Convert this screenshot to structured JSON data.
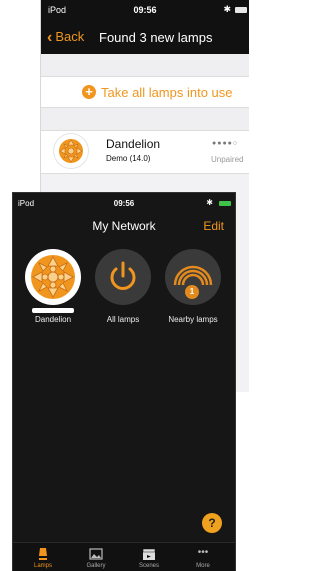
{
  "back_screen": {
    "status": {
      "carrier": "iPod",
      "time": "09:56"
    },
    "nav": {
      "back_label": "Back",
      "title": "Found 3 new lamps"
    },
    "take_all_label": "Take all lamps into use",
    "lamp": {
      "name": "Dandelion",
      "subtitle": "Demo (14.0)",
      "signal": "●●●●○",
      "status": "Unpaired"
    }
  },
  "front_screen": {
    "status": {
      "carrier": "iPod",
      "time": "09:56"
    },
    "nav": {
      "title": "My Network",
      "edit_label": "Edit"
    },
    "tiles": [
      {
        "label": "Dandelion",
        "icon": "dandelion-lamp-icon"
      },
      {
        "label": "All lamps",
        "icon": "power-icon"
      },
      {
        "label": "Nearby lamps",
        "icon": "signal-waves-icon",
        "badge": "1"
      }
    ],
    "help_label": "?",
    "tabbar": [
      {
        "label": "Lamps",
        "icon": "lamp-icon",
        "active": true
      },
      {
        "label": "Gallery",
        "icon": "gallery-icon"
      },
      {
        "label": "Scenes",
        "icon": "clapperboard-icon"
      },
      {
        "label": "More",
        "icon": "more-dots-icon"
      }
    ]
  },
  "colors": {
    "accent": "#f0961e",
    "dark_bg": "#161616",
    "badge": "#e28a1e",
    "battery_green": "#3fc24a"
  }
}
